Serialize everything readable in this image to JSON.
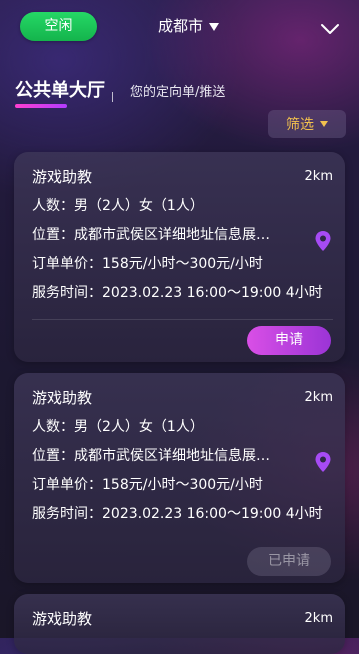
{
  "header": {
    "status": "空闲",
    "city": "成都市"
  },
  "tabs": {
    "active": "公共单大厅",
    "inactive": "您的定向单/推送"
  },
  "filter": {
    "label": "筛选"
  },
  "colors": {
    "status_green": "#1ec75a",
    "accent_purple": "#b23cff",
    "accent_pink": "#ff3fd0",
    "filter_gold": "#f2c14e"
  },
  "icons": {
    "city_dropdown": "triangle-down-icon",
    "header_menu": "chevron-down-icon",
    "filter_dropdown": "triangle-down-icon",
    "location": "location-pin-icon"
  },
  "orders": [
    {
      "title": "游戏助教",
      "distance": "2km",
      "people": "人数：男（2人）女（1人）",
      "location": "位置：成都市武侯区详细地址信息展…",
      "price": "订单单价：158元/小时～300元/小时",
      "time": "服务时间：2023.02.23  16:00～19:00 4小时",
      "action": "申请"
    },
    {
      "title": "游戏助教",
      "distance": "2km",
      "people": "人数：男（2人）女（1人）",
      "location": "位置：成都市武侯区详细地址信息展…",
      "price": "订单单价：158元/小时～300元/小时",
      "time": "服务时间：2023.02.23  16:00～19:00 4小时",
      "action": "已申请"
    },
    {
      "title": "游戏助教",
      "distance": "2km"
    }
  ]
}
